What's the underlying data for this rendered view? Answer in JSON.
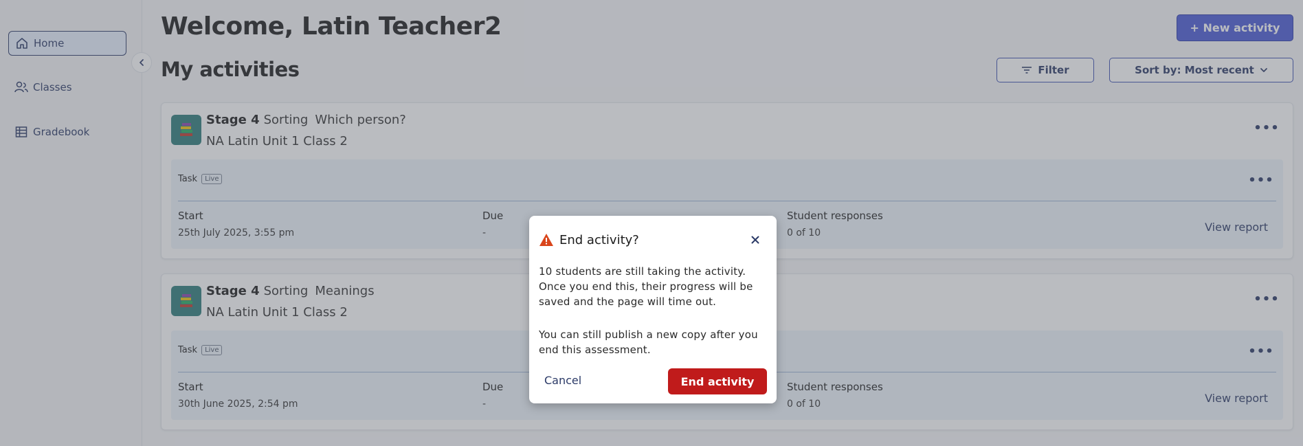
{
  "sidebar": {
    "items": [
      {
        "label": "Home",
        "icon": "home-icon",
        "active": true
      },
      {
        "label": "Classes",
        "icon": "users-icon",
        "active": false
      },
      {
        "label": "Gradebook",
        "icon": "table-icon",
        "active": false
      }
    ]
  },
  "header": {
    "title": "Welcome, Latin Teacher2",
    "new_activity_label": "+ New activity"
  },
  "activities": {
    "title": "My activities",
    "filter_label": "Filter",
    "sort_label": "Sort by: Most recent",
    "columns": {
      "start": "Start",
      "due": "Due",
      "responses": "Student responses"
    },
    "cards": [
      {
        "stage": "Stage 4",
        "type": "Sorting",
        "name": "Which person?",
        "class_name": "NA Latin Unit 1 Class 2",
        "task_label": "Task",
        "status": "Live",
        "start": "25th July 2025, 3:55 pm",
        "due": "-",
        "responses": "0 of 10",
        "view_report": "View report"
      },
      {
        "stage": "Stage 4",
        "type": "Sorting",
        "name": "Meanings",
        "class_name": "NA Latin Unit 1 Class 2",
        "task_label": "Task",
        "status": "Live",
        "start": "30th June 2025, 2:54 pm",
        "due": "-",
        "responses": "0 of 10",
        "view_report": "View report"
      }
    ]
  },
  "modal": {
    "title": "End activity?",
    "body_1": "10 students are still taking the activity. Once you end this, their progress will be saved and the page will time out.",
    "body_2": "You can still publish a new copy after you end this assessment.",
    "cancel_label": "Cancel",
    "confirm_label": "End activity"
  },
  "colors": {
    "accent": "#4b5bd6",
    "navy": "#2b3a67",
    "danger": "#c01b1b",
    "warning": "#d9451b"
  }
}
